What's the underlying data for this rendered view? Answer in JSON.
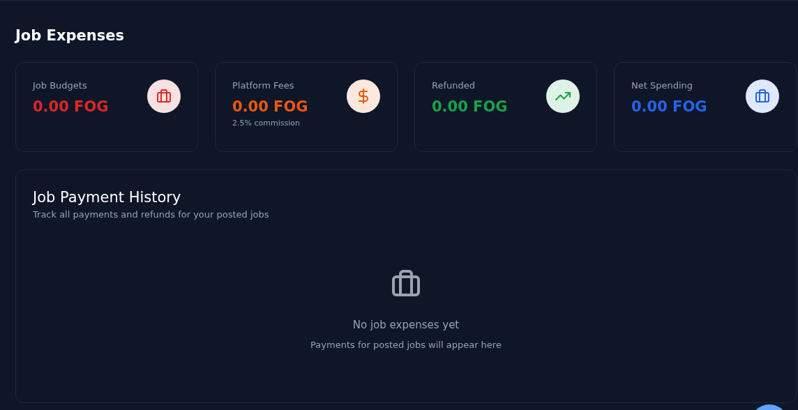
{
  "page_title": "Job Expenses",
  "stats": [
    {
      "label": "Job Budgets",
      "value": "0.00 FOG",
      "color": "#dc2626",
      "kind": "briefcase"
    },
    {
      "label": "Platform Fees",
      "value": "0.00 FOG",
      "color": "#ea580c",
      "kind": "dollar",
      "note": "2.5% commission"
    },
    {
      "label": "Refunded",
      "value": "0.00 FOG",
      "color": "#16a34a",
      "kind": "trend"
    },
    {
      "label": "Net Spending",
      "value": "0.00 FOG",
      "color": "#2563eb",
      "kind": "briefcase"
    }
  ],
  "history": {
    "title": "Job Payment History",
    "subtitle": "Track all payments and refunds for your posted jobs",
    "empty_title": "No job expenses yet",
    "empty_text": "Payments for posted jobs will appear here"
  }
}
